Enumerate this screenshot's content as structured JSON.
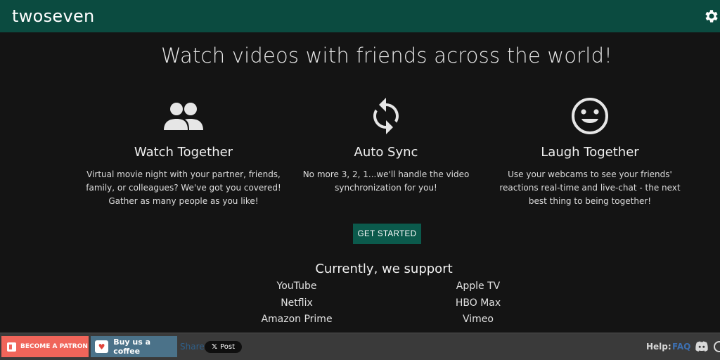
{
  "header": {
    "brand": "twoseven",
    "settings_icon": "gear-icon",
    "bar_color": "#0b4b40"
  },
  "hero": {
    "title": "Watch videos with friends across the world!"
  },
  "features": [
    {
      "icon": "people-icon",
      "title": "Watch Together",
      "lines": [
        "Virtual movie night with your partner, friends,",
        "family, or colleagues? We've got you covered!",
        "Gather as many people as you like!"
      ]
    },
    {
      "icon": "sync-icon",
      "title": "Auto Sync",
      "lines": [
        "No more 3, 2, 1...we'll handle the video",
        "synchronization for you!"
      ]
    },
    {
      "icon": "smiley-icon",
      "title": "Laugh Together",
      "lines": [
        "Use your webcams to see your friends'",
        "reactions real-time and live-chat - the next",
        "best thing to being together!"
      ]
    }
  ],
  "cta": {
    "label": "GET STARTED",
    "color": "#0b5a4c"
  },
  "support": {
    "title": "Currently, we support",
    "left": [
      "YouTube",
      "Netflix",
      "Amazon Prime"
    ],
    "right": [
      "Apple TV",
      "HBO Max",
      "Vimeo"
    ]
  },
  "footer": {
    "patron_label": "BECOME A PATRON",
    "coffee_label": "Buy us a coffee",
    "share_label": "Share",
    "x_post_label": "Post",
    "help_label": "Help:",
    "faq_label": "FAQ",
    "discord_icon": "discord-icon",
    "patron_color": "#f0655a",
    "coffee_color": "#4b7289"
  }
}
